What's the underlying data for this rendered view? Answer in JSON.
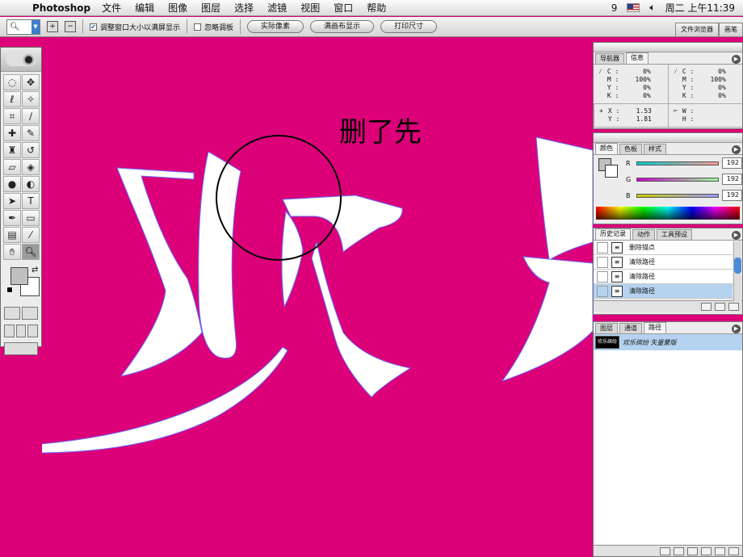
{
  "menubar": {
    "app": "Photoshop",
    "items": [
      "文件",
      "编辑",
      "图像",
      "图层",
      "选择",
      "滤镜",
      "视图",
      "窗口",
      "帮助"
    ],
    "status_digit": "9",
    "clock": "周二 上午11:39"
  },
  "options": {
    "checkbox1_label": "调整窗口大小以满屏显示",
    "checkbox2_label": "忽略调板",
    "buttons": [
      "实际像素",
      "满画布显示",
      "打印尺寸"
    ]
  },
  "file_tabs": [
    "文件浏览器",
    "画笔"
  ],
  "annotation": {
    "text": "删了先"
  },
  "navigator": {
    "tabs": [
      "导航器",
      "信息"
    ],
    "left_cmyk": [
      [
        "C :",
        "0%"
      ],
      [
        "M :",
        "100%"
      ],
      [
        "Y :",
        "0%"
      ],
      [
        "K :",
        "0%"
      ]
    ],
    "right_cmyk": [
      [
        "C :",
        "0%"
      ],
      [
        "M :",
        "100%"
      ],
      [
        "Y :",
        "0%"
      ],
      [
        "K :",
        "0%"
      ]
    ],
    "xy": [
      [
        "X :",
        "1.53"
      ],
      [
        "Y :",
        "1.81"
      ]
    ],
    "wh": [
      [
        "W :",
        ""
      ],
      [
        "H :",
        ""
      ]
    ]
  },
  "color": {
    "tabs": [
      "颜色",
      "色板",
      "样式"
    ],
    "channels": [
      {
        "label": "R",
        "value": "192"
      },
      {
        "label": "G",
        "value": "192"
      },
      {
        "label": "B",
        "value": "192"
      }
    ]
  },
  "history": {
    "tabs": [
      "历史记录",
      "动作",
      "工具预设"
    ],
    "items": [
      "删除锚点",
      "清除路径",
      "清除路径",
      "清除路径"
    ]
  },
  "paths": {
    "tabs": [
      "图层",
      "通道",
      "路径"
    ],
    "item": "欢乐缤纷 矢量蒙版",
    "thumb_text": "欢乐缤纷"
  },
  "colors": {
    "canvas": "#dc0079",
    "highlight": "#b5d3f0"
  }
}
